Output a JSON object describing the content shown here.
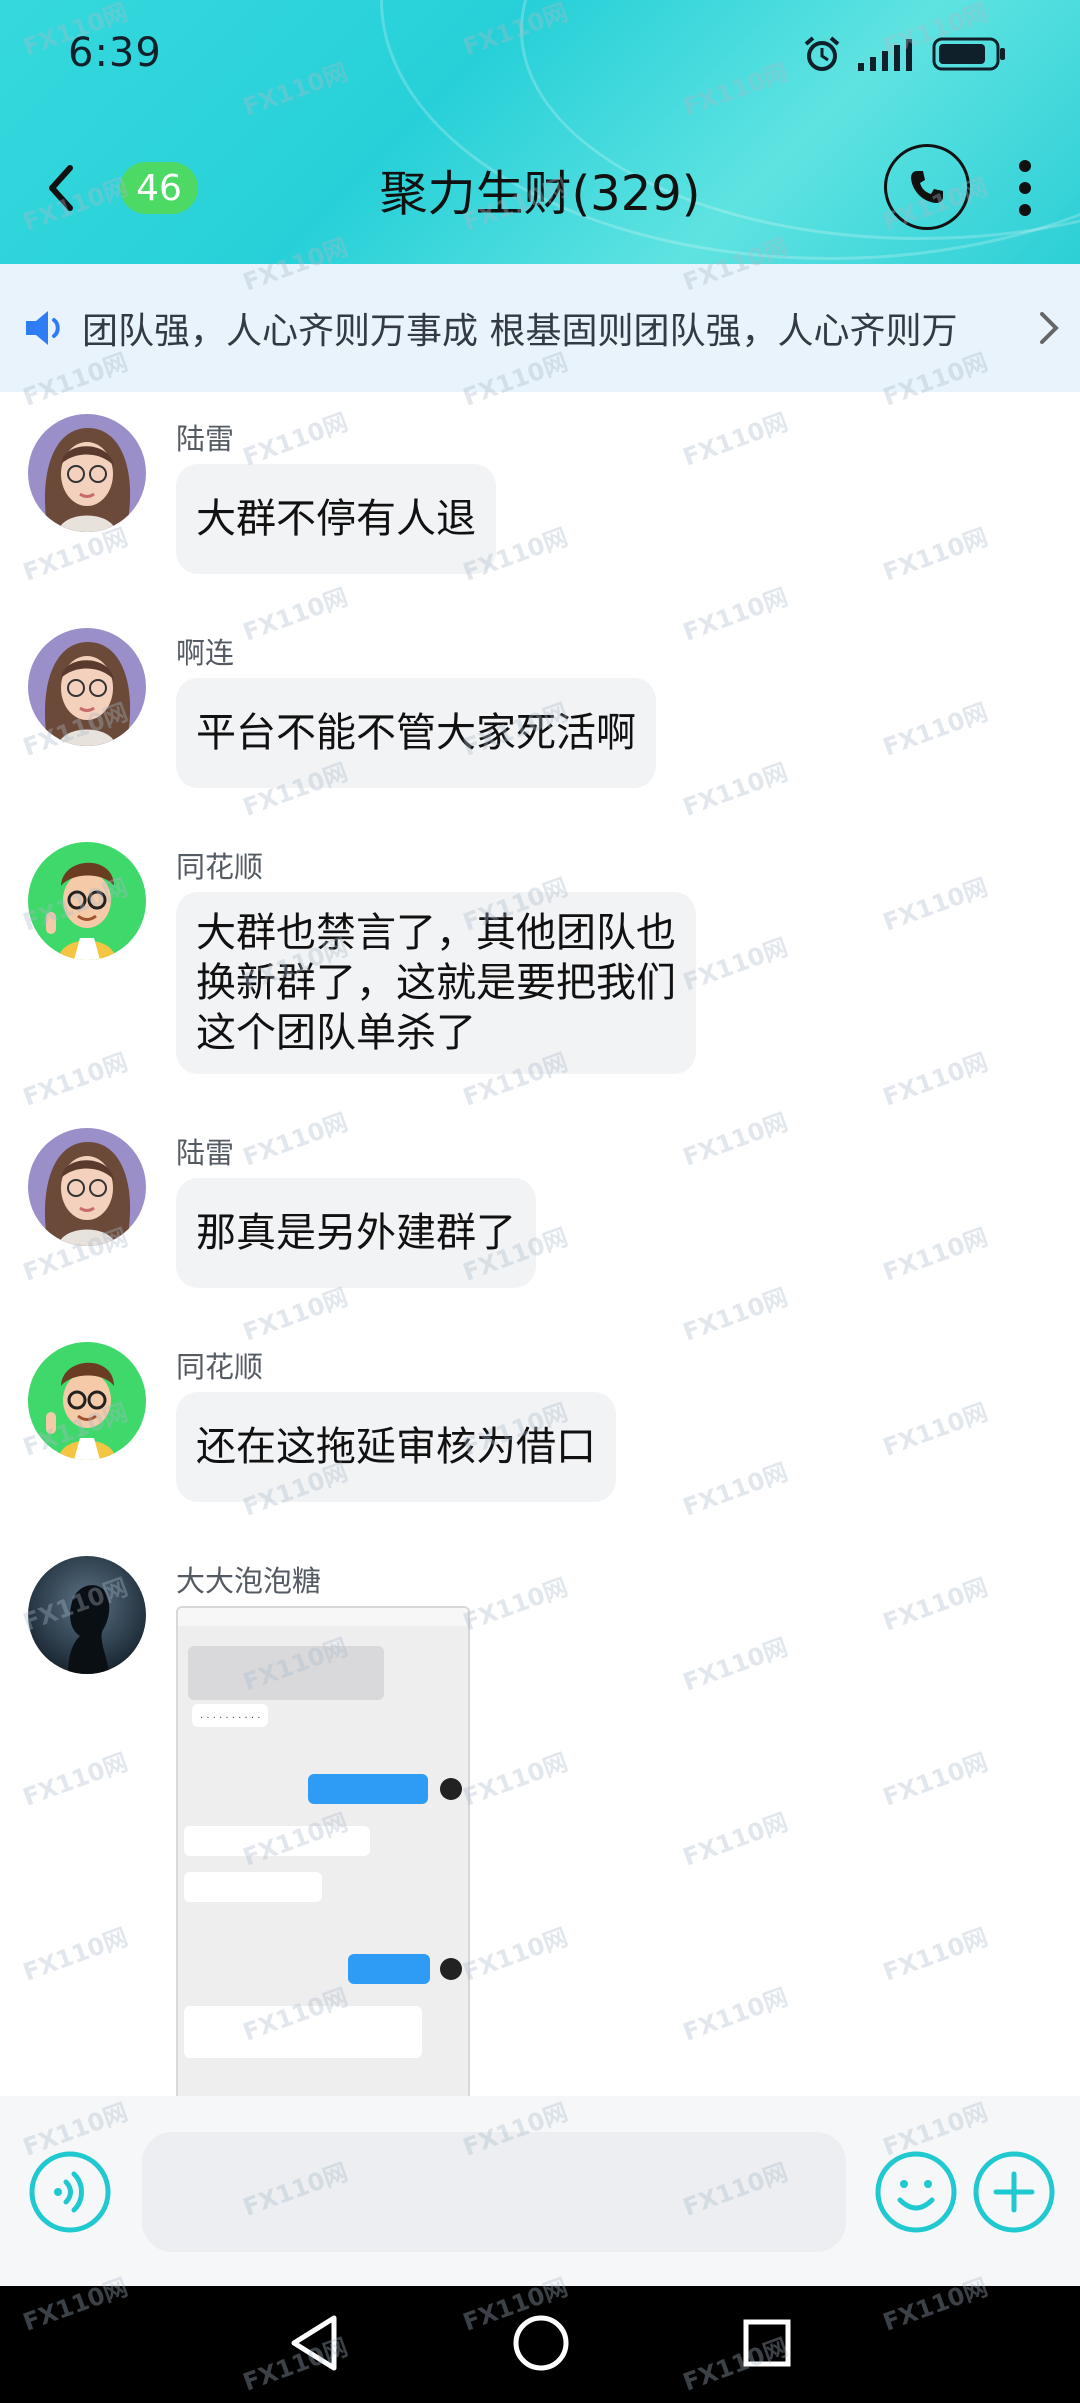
{
  "status_bar": {
    "time": "6:39",
    "icons": [
      "alarm-icon",
      "signal-icon",
      "battery-icon"
    ]
  },
  "header": {
    "unread_count": "46",
    "title": "聚力生财(329)",
    "icons": [
      "back-icon",
      "phone-icon",
      "more-icon"
    ]
  },
  "announcement": {
    "text": "团队强，人心齐则万事成     根基固则团队强，人心齐则万"
  },
  "messages": [
    {
      "sender": "陆雷",
      "text": "大群不停有人退",
      "avatar": "female-avatar"
    },
    {
      "sender": "啊连",
      "text": "平台不能不管大家死活啊",
      "avatar": "female-avatar"
    },
    {
      "sender": "同花顺",
      "text": "大群也禁言了，其他团队也\n换新群了，这就是要把我们\n这个团队单杀了",
      "avatar": "male-cartoon-avatar"
    },
    {
      "sender": "陆雷",
      "text": "那真是另外建群了",
      "avatar": "female-avatar"
    },
    {
      "sender": "同花顺",
      "text": "还在这拖延审核为借口",
      "avatar": "male-cartoon-avatar"
    },
    {
      "sender": "大大泡泡糖",
      "type": "image",
      "avatar": "silhouette-avatar"
    }
  ],
  "input_bar": {
    "placeholder": "",
    "icons": [
      "voice-icon",
      "emoji-icon",
      "add-icon"
    ]
  },
  "system_nav": {
    "icons": [
      "back-triangle-icon",
      "home-circle-icon",
      "recents-square-icon"
    ]
  },
  "watermark": "FX110网",
  "colors": {
    "header": "#2ccfd6",
    "badge": "#4cd964",
    "bubble": "#f2f3f5",
    "accent": "#20c9d0",
    "announce_bg": "#e9f3fb"
  }
}
